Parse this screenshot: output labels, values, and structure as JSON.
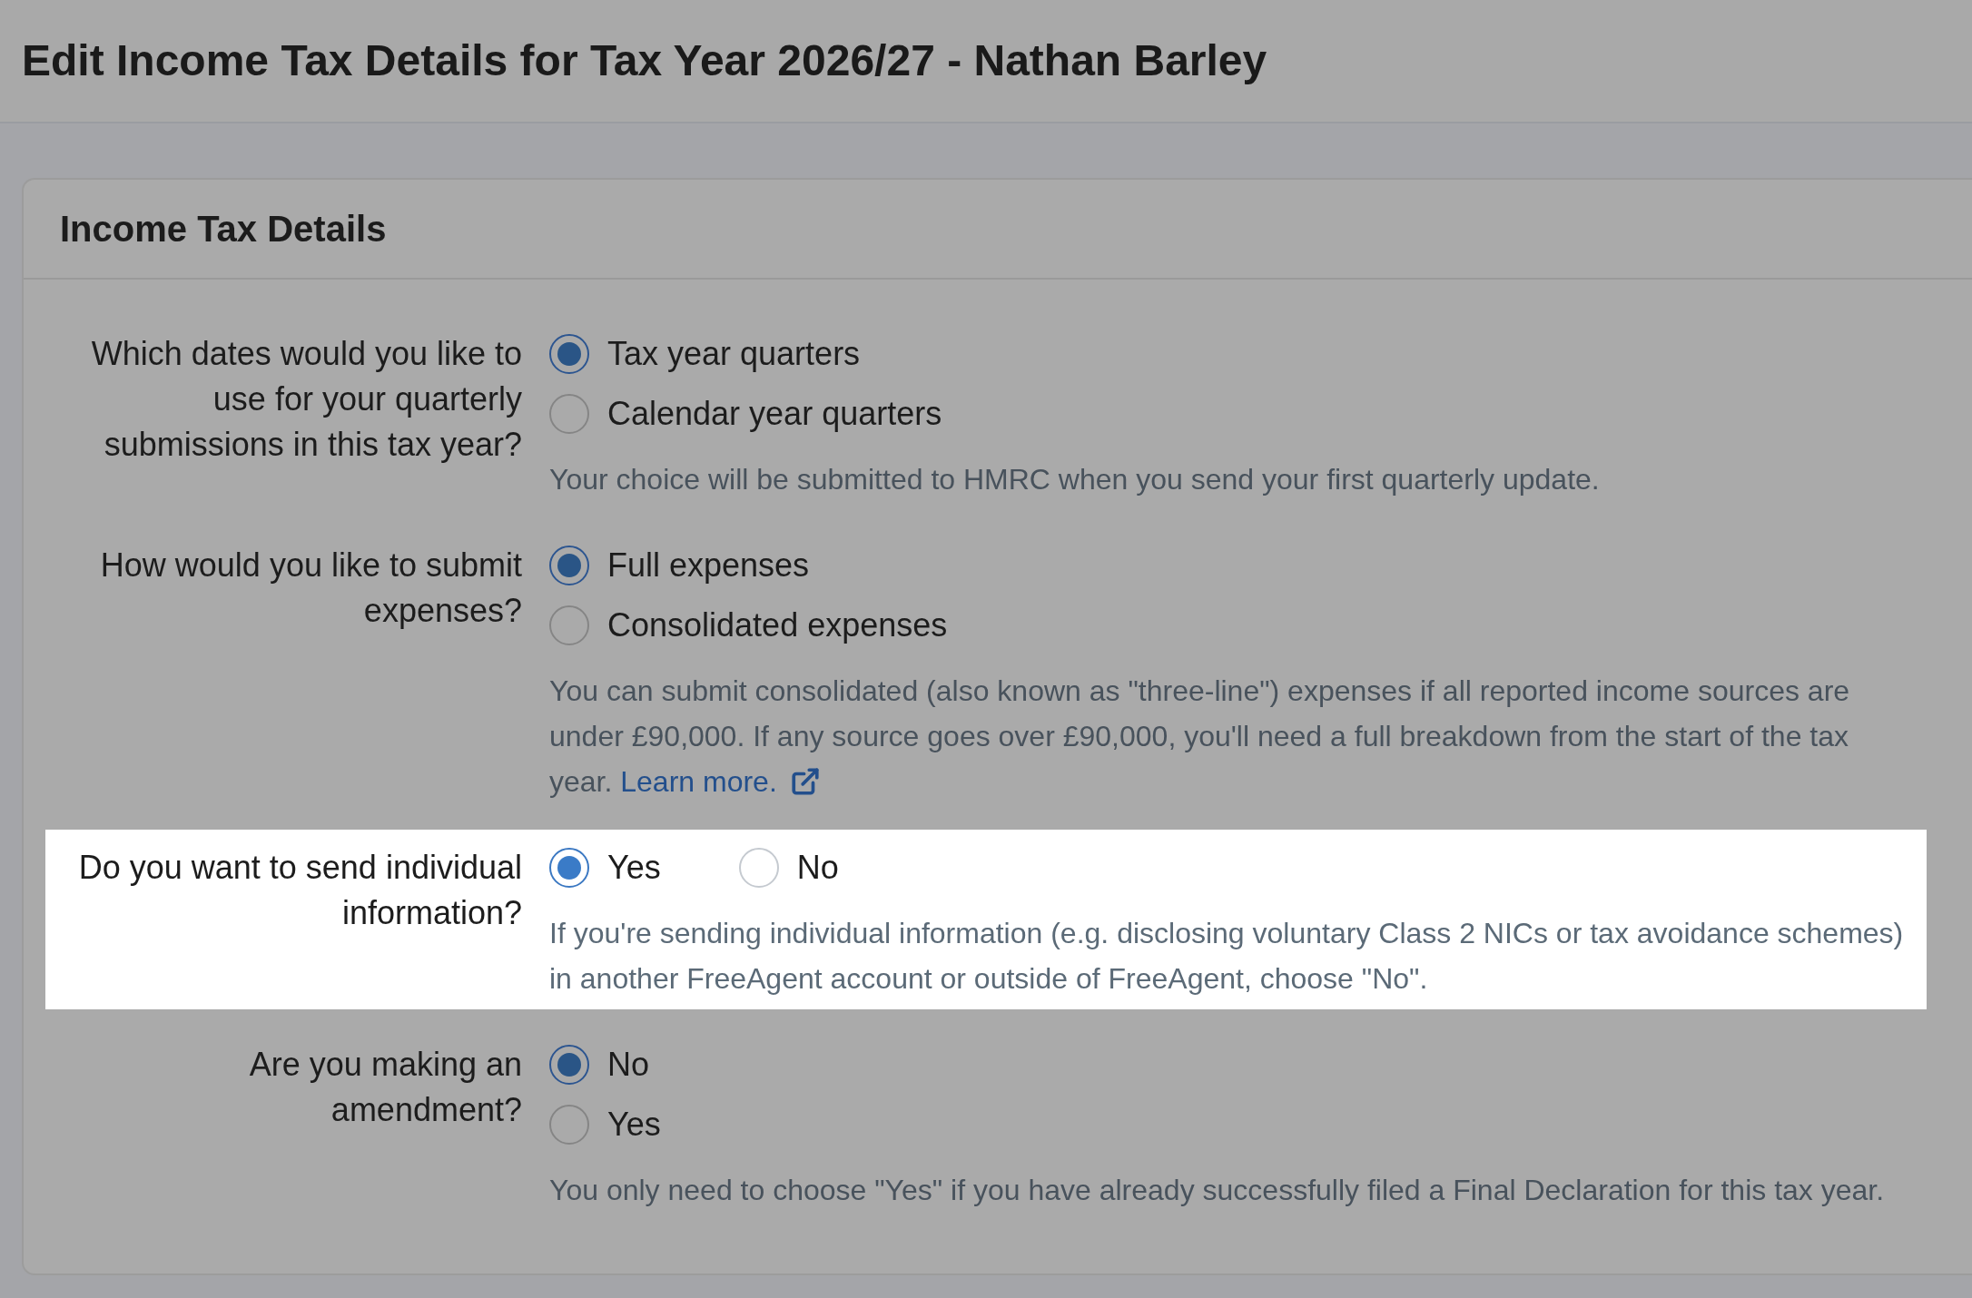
{
  "page": {
    "title": "Edit Income Tax Details for Tax Year 2026/27 - Nathan Barley"
  },
  "card": {
    "title": "Income Tax Details",
    "questions": [
      {
        "label": "Which dates would you like to use for your quarterly submissions in this tax year?",
        "highlighted": false,
        "inline": false,
        "options": [
          {
            "label": "Tax year quarters",
            "selected": true
          },
          {
            "label": "Calendar year quarters",
            "selected": false
          }
        ],
        "help": "Your choice will be submitted to HMRC when you send your first quarterly update."
      },
      {
        "label": "How would you like to submit expenses?",
        "highlighted": false,
        "inline": false,
        "options": [
          {
            "label": "Full expenses",
            "selected": true
          },
          {
            "label": "Consolidated expenses",
            "selected": false
          }
        ],
        "help": "You can submit consolidated (also known as \"three-line\") expenses if all reported income sources are under £90,000. If any source goes over £90,000, you'll need a full breakdown from the start of the tax year.",
        "link": {
          "label": "Learn more."
        }
      },
      {
        "label": "Do you want to send individual information?",
        "highlighted": true,
        "inline": true,
        "options": [
          {
            "label": "Yes",
            "selected": true
          },
          {
            "label": "No",
            "selected": false
          }
        ],
        "help": "If you're sending individual information (e.g. disclosing voluntary Class 2 NICs or tax avoidance schemes) in another FreeAgent account or outside of FreeAgent, choose \"No\"."
      },
      {
        "label": "Are you making an amendment?",
        "highlighted": false,
        "inline": false,
        "options": [
          {
            "label": "No",
            "selected": true
          },
          {
            "label": "Yes",
            "selected": false
          }
        ],
        "help": "You only need to choose \"Yes\" if you have already successfully filed a Final Declaration for this tax year."
      }
    ]
  }
}
